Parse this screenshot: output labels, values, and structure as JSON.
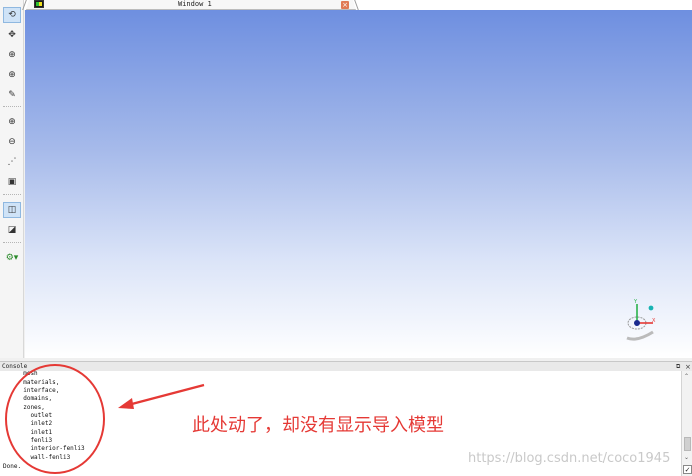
{
  "window_tab": {
    "title": "Window 1",
    "close_symbol": "×"
  },
  "toolbar": {
    "tools": [
      {
        "name": "rotate-view-icon",
        "glyph": "⟲",
        "active": true
      },
      {
        "name": "pan-icon",
        "glyph": "✥"
      },
      {
        "name": "zoom-icon",
        "glyph": "⊕"
      },
      {
        "name": "zoom-in-icon",
        "glyph": "⊕"
      },
      {
        "name": "probe-icon",
        "glyph": "✎"
      },
      {
        "name": "zoom-to-fit-icon",
        "glyph": "⊕"
      },
      {
        "name": "zoom-out-icon",
        "glyph": "⊖"
      },
      {
        "name": "distance-icon",
        "glyph": "⋰"
      },
      {
        "name": "screenshot-icon",
        "glyph": "▣"
      },
      {
        "name": "orthographic-icon",
        "glyph": "◫",
        "active": true
      },
      {
        "name": "perspective-icon",
        "glyph": "◪"
      },
      {
        "name": "view-options-icon",
        "glyph": "⚙▾"
      }
    ]
  },
  "console": {
    "title": "Console",
    "float_symbol": "⧉",
    "close_symbol": "×",
    "lines": [
      "  mesh",
      "  materials,",
      "  interface,",
      "  domains,",
      "  zones,",
      "    outlet",
      "    inlet2",
      "    inlet1",
      "    fenli3",
      "    interior-fenli3",
      "    wall-fenli3",
      "Done."
    ],
    "scrollbar": {
      "up": "⌃",
      "down": "⌄",
      "check": "✓"
    }
  },
  "axis_triad": {
    "x_label": "X",
    "y_label": "Y"
  },
  "annotation": {
    "text": "此处动了，却没有显示导入模型",
    "color": "#e53935"
  },
  "watermark": "https://blog.csdn.net/coco1945"
}
